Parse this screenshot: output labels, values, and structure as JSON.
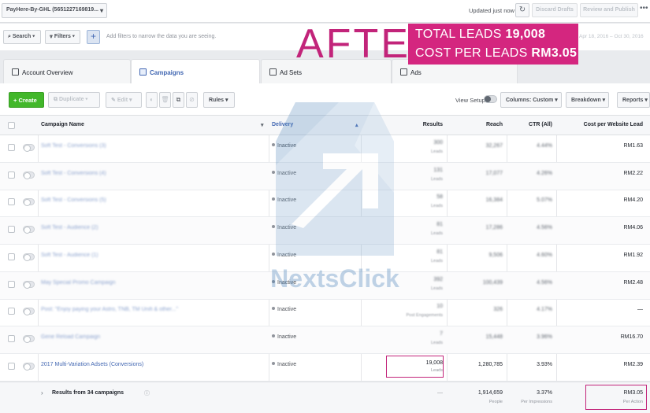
{
  "topbar": {
    "account": "PayHere-By-GHL (5651227169819...",
    "updated": "Updated just now",
    "discard_label": "Discard Drafts",
    "review_label": "Review and Publish"
  },
  "filterbar": {
    "search_label": "Search",
    "filters_label": "Filters",
    "hint": "Add filters to narrow the data you are seeing.",
    "date_range": "Apr 18, 2016 – Oct 30, 2016"
  },
  "overlay": {
    "after": "AFTER",
    "total_leads_label": "TOTAL LEADS",
    "total_leads_value": "19,008",
    "cost_label": "COST PER LEADS",
    "cost_value": "RM3.05"
  },
  "tabs": [
    {
      "label": "Account Overview",
      "active": false
    },
    {
      "label": "Campaigns",
      "active": true
    },
    {
      "label": "Ad Sets",
      "active": false
    },
    {
      "label": "Ads",
      "active": false
    }
  ],
  "toolbar": {
    "create": "Create",
    "duplicate": "Duplicate",
    "edit": "Edit",
    "rules": "Rules",
    "view_setup": "View Setup",
    "columns": "Columns: Custom",
    "breakdown": "Breakdown",
    "reports": "Reports"
  },
  "columns": {
    "name": "Campaign Name",
    "delivery": "Delivery",
    "results": "Results",
    "reach": "Reach",
    "ctr": "CTR (All)",
    "cost": "Cost per Website Lead"
  },
  "rows": [
    {
      "name": "Soft Test - Conversions (3)",
      "status": "Inactive",
      "results": "300",
      "result_type": "Leads",
      "reach": "32,267",
      "ctr": "4.44%",
      "cost": "RM1.63",
      "blurred": true
    },
    {
      "name": "Soft Test - Conversions (4)",
      "status": "Inactive",
      "results": "131",
      "result_type": "Leads",
      "reach": "17,077",
      "ctr": "4.26%",
      "cost": "RM2.22",
      "blurred": true
    },
    {
      "name": "Soft Test - Conversions (5)",
      "status": "Inactive",
      "results": "58",
      "result_type": "Leads",
      "reach": "16,384",
      "ctr": "5.07%",
      "cost": "RM4.20",
      "blurred": true
    },
    {
      "name": "Soft Test - Audience (2)",
      "status": "Inactive",
      "results": "81",
      "result_type": "Leads",
      "reach": "17,286",
      "ctr": "4.56%",
      "cost": "RM4.06",
      "blurred": true
    },
    {
      "name": "Soft Test - Audience (1)",
      "status": "Inactive",
      "results": "81",
      "result_type": "Leads",
      "reach": "9,506",
      "ctr": "4.60%",
      "cost": "RM1.92",
      "blurred": true
    },
    {
      "name": "May Special Promo Campaign",
      "status": "Inactive",
      "results": "392",
      "result_type": "Leads",
      "reach": "100,439",
      "ctr": "4.56%",
      "cost": "RM2.48",
      "blurred": true
    },
    {
      "name": "Post: \"Enjoy paying your Astro, TNB, TM Unifi & other...\"",
      "status": "Inactive",
      "results": "10",
      "result_type": "Post Engagements",
      "reach": "326",
      "ctr": "4.17%",
      "cost": "—",
      "blurred": true
    },
    {
      "name": "Gene Reload Campaign",
      "status": "Inactive",
      "results": "7",
      "result_type": "Leads",
      "reach": "15,448",
      "ctr": "3.96%",
      "cost": "RM16.70",
      "blurred": true
    },
    {
      "name": "2017 Multi-Variation Adsets (Conversions)",
      "status": "Inactive",
      "results": "19,008",
      "result_type": "Leads",
      "reach": "1,280,785",
      "ctr": "3.93%",
      "cost": "RM2.39",
      "blurred": false
    }
  ],
  "totals": {
    "label": "Results from 34 campaigns",
    "results": "—",
    "reach": "1,914,659",
    "reach_sub": "People",
    "ctr": "3.37%",
    "ctr_sub": "Per Impressions",
    "cost": "RM3.05",
    "cost_sub": "Per Action"
  },
  "watermark": {
    "brand": "NextsClick"
  },
  "colors": {
    "accent": "#4267b2",
    "highlight": "#c2247a",
    "create_green": "#42b72a"
  }
}
